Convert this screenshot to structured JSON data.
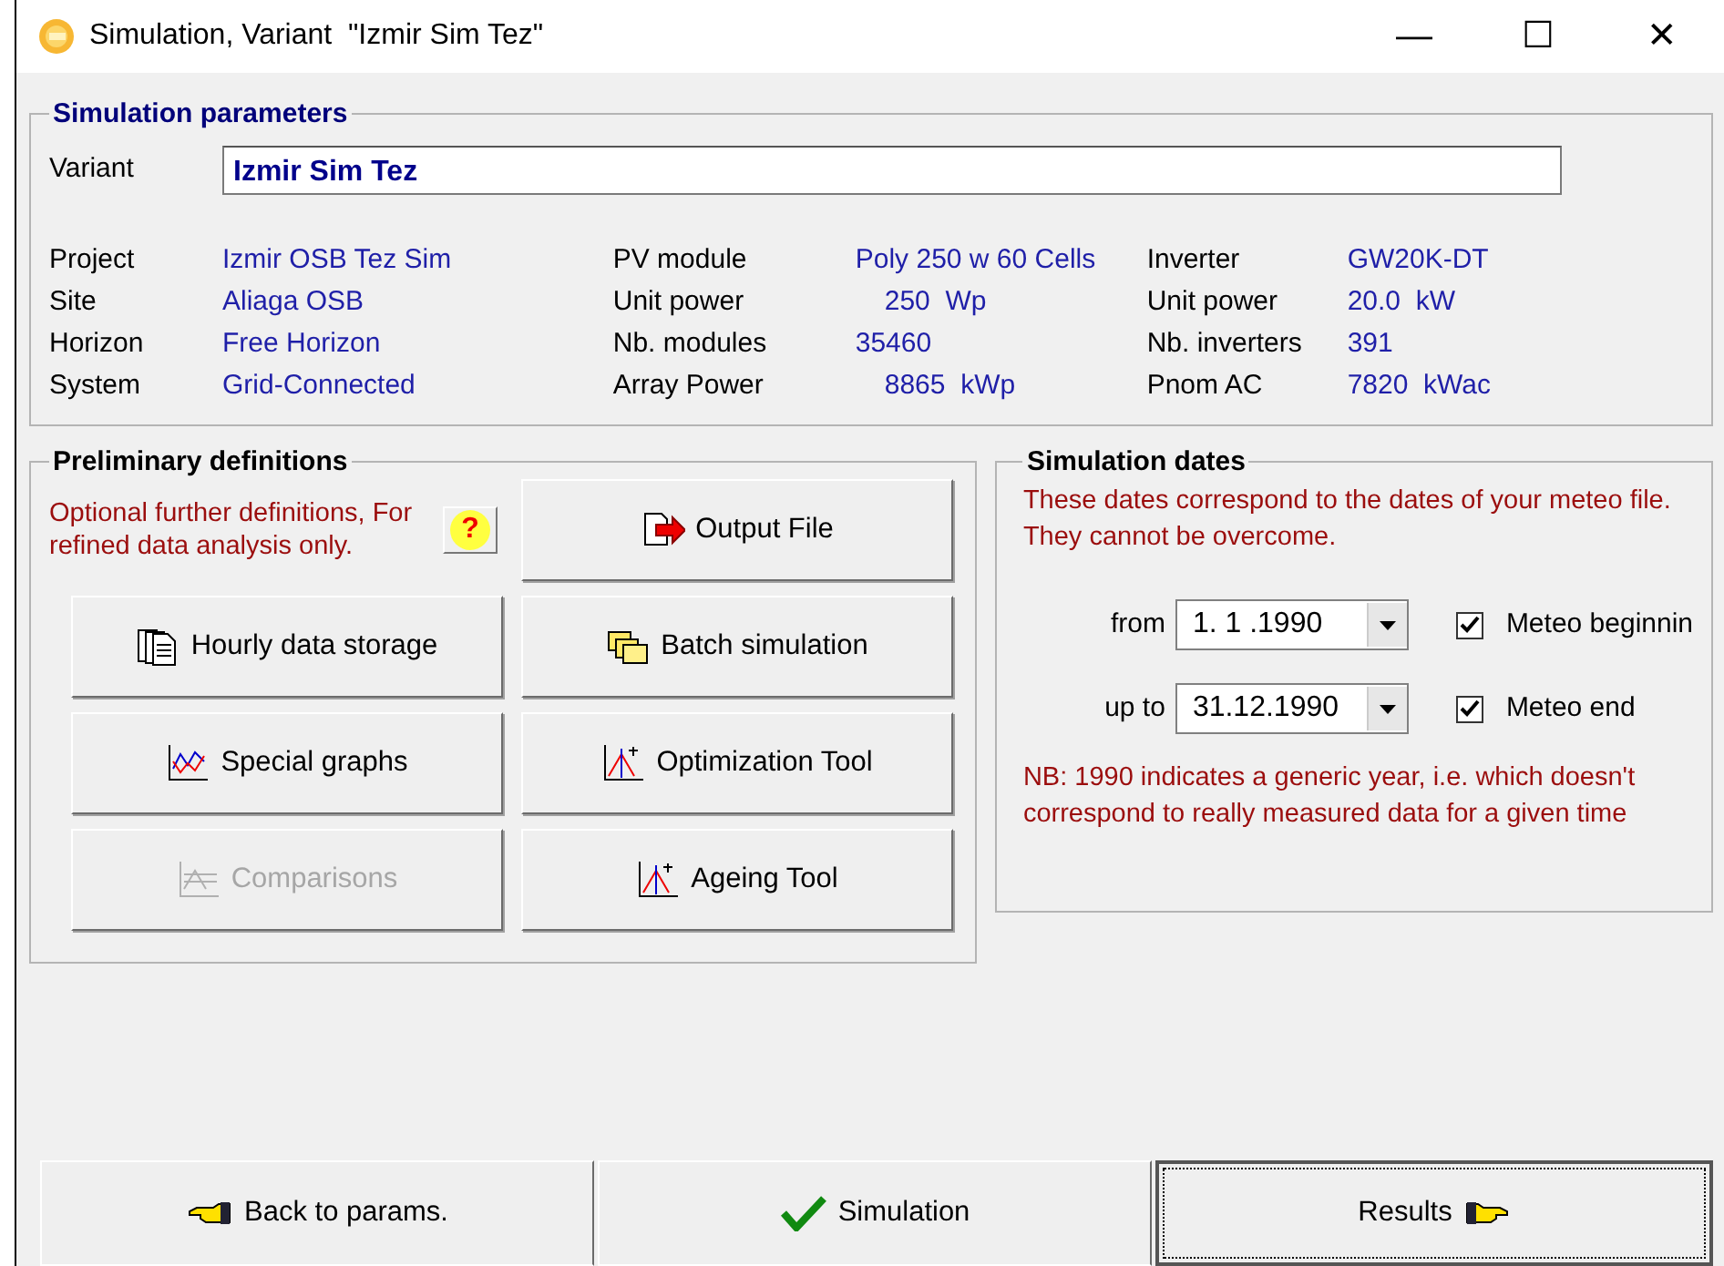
{
  "window": {
    "title": "Simulation, Variant  \"Izmir Sim Tez\"",
    "controls": [
      "—",
      "☐",
      "✕"
    ]
  },
  "parameters": {
    "title": "Simulation parameters",
    "variant": {
      "label": "Variant",
      "value": "Izmir Sim Tez"
    },
    "columns": [
      {
        "rows": [
          {
            "label": "Project",
            "value": "Izmir OSB Tez Sim"
          },
          {
            "label": "Site",
            "value": "Aliaga OSB"
          },
          {
            "label": "Horizon",
            "value": "Free Horizon"
          },
          {
            "label": "System",
            "value": "Grid-Connected"
          }
        ]
      },
      {
        "rows": [
          {
            "label": "PV module",
            "value": "Poly 250 w 60 Cells"
          },
          {
            "label": "Unit power",
            "value": "250",
            "unit": "Wp"
          },
          {
            "label": "Nb. modules",
            "value": "35460"
          },
          {
            "label": "Array Power",
            "value": "8865",
            "unit": "kWp"
          }
        ]
      },
      {
        "rows": [
          {
            "label": "Inverter",
            "value": "GW20K-DT"
          },
          {
            "label": "Unit power",
            "value": "20.0",
            "unit": "kW"
          },
          {
            "label": "Nb. inverters",
            "value": "391"
          },
          {
            "label": "Pnom AC",
            "value": "7820",
            "unit": "kWac"
          }
        ]
      }
    ]
  },
  "preliminary": {
    "title": "Preliminary definitions",
    "note": "Optional further definitions, For refined data analysis only.",
    "help": "?",
    "buttons": [
      {
        "label": "Output File",
        "disabled": false
      },
      {
        "label": "Hourly data storage",
        "disabled": false
      },
      {
        "label": "Batch simulation",
        "disabled": false
      },
      {
        "label": "Special graphs",
        "disabled": false
      },
      {
        "label": "Optimization Tool",
        "disabled": false
      },
      {
        "label": "Comparisons",
        "disabled": true
      },
      {
        "label": "Ageing Tool",
        "disabled": false
      }
    ]
  },
  "dates": {
    "title": "Simulation dates",
    "note": "These dates correspond to the dates of  your meteo file. They cannot be overcome.",
    "rows": [
      {
        "label": "from",
        "value": "1. 1 .1990",
        "check": "Meteo beginnin",
        "checked": true
      },
      {
        "label": "up to",
        "value": "31.12.1990",
        "check": "Meteo end",
        "checked": true
      }
    ],
    "nb": "NB: 1990 indicates a generic year, i.e. which doesn't correspond to really measured data for a given time"
  },
  "footer": [
    {
      "label": "Back to params.",
      "focused": false
    },
    {
      "label": "Simulation",
      "focused": false
    },
    {
      "label": "Results",
      "focused": true
    }
  ]
}
